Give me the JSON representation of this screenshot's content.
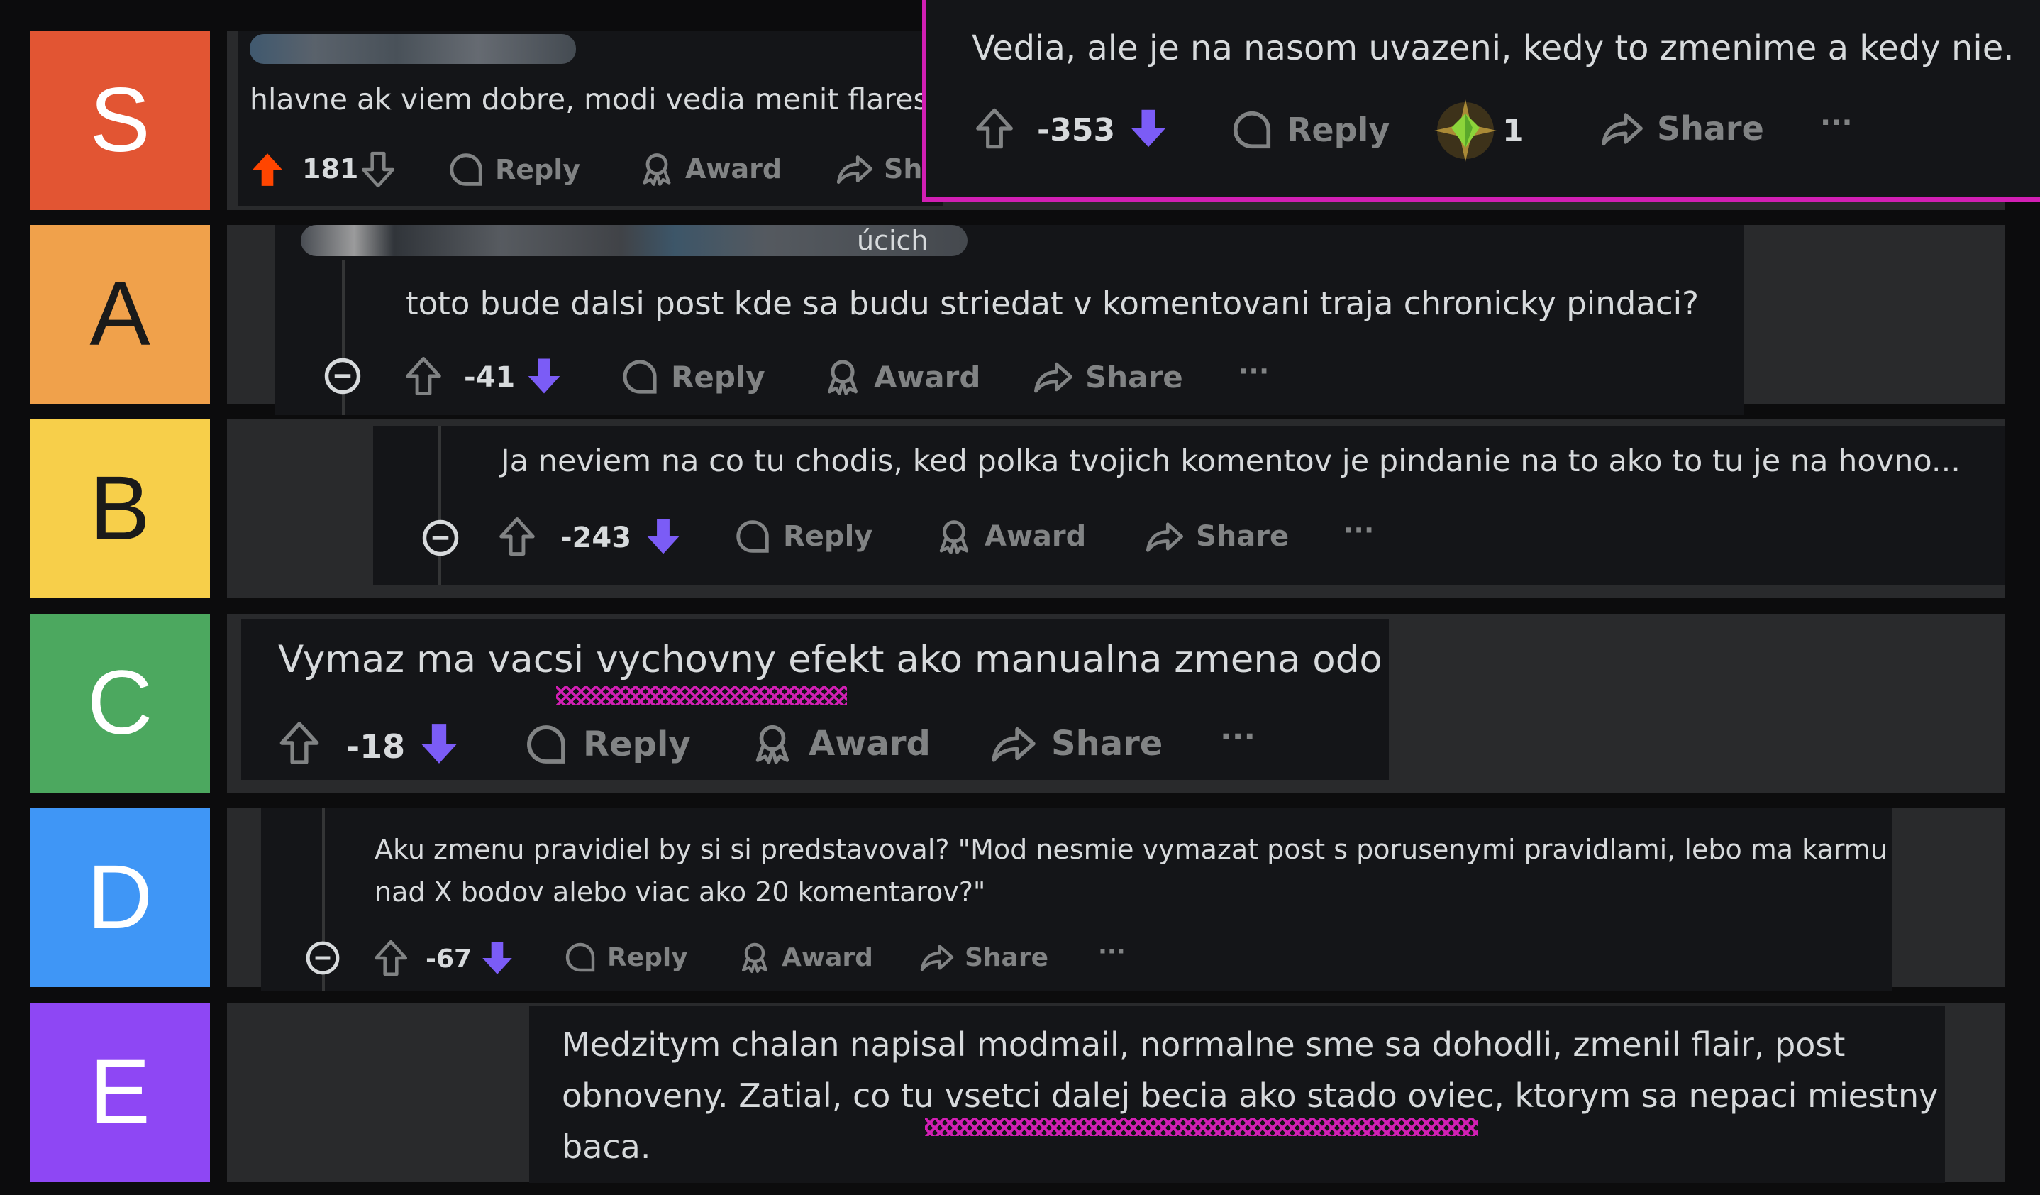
{
  "tiers": [
    {
      "label": "S",
      "color": "#e25533"
    },
    {
      "label": "A",
      "color": "#f0a14b"
    },
    {
      "label": "B",
      "color": "#f7cf4a"
    },
    {
      "label": "C",
      "color": "#4ca85f"
    },
    {
      "label": "D",
      "color": "#3f96f6"
    },
    {
      "label": "E",
      "color": "#8e47f4"
    }
  ],
  "colors": {
    "downvote": "#7b5cf6",
    "upvote_active": "#ff4500",
    "highlight_border": "#d21fb4",
    "icon": "#818384"
  },
  "actions": {
    "reply": "Reply",
    "award": "Award",
    "share": "Share",
    "share_cut": "Sha",
    "more": "···"
  },
  "comments": {
    "s": {
      "text": "hlavne ak viem dobre, modi vedia menit flares",
      "score": "181"
    },
    "s_pop": {
      "text": "Vedia, ale je na nasom uvazeni, kedy to zmenime a kedy nie.",
      "score": "-353",
      "award_count": "1"
    },
    "a": {
      "user_tail": "úcich",
      "text": "toto bude dalsi post kde sa budu striedat v komentovani traja chronicky pindaci?",
      "score": "-41"
    },
    "b": {
      "text": "Ja neviem na co tu chodis, ked polka tvojich komentov je pindanie na to ako to tu je na hovno...",
      "score": "-243"
    },
    "c": {
      "text": "Vymaz ma vacsi vychovny efekt ako manualna zmena odo mna,",
      "score": "-18"
    },
    "d": {
      "line1": "Aku zmenu pravidiel by si si predstavoval? \"Mod nesmie vymazat post s porusenymi pravidlami, lebo ma karmu",
      "line2": "nad X bodov alebo viac ako 20 komentarov?\"",
      "score": "-67"
    },
    "e": {
      "line1": "Medzitym chalan napisal modmail, normalne sme sa dohodli, zmenil flair, post",
      "line2": "obnoveny. Zatial, co tu vsetci dalej becia ako stado oviec, ktorym sa nepaci miestny",
      "line3": "baca."
    }
  }
}
